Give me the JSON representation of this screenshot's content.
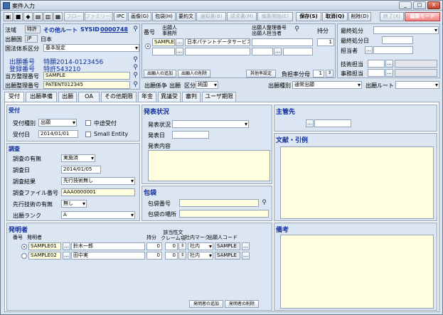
{
  "window": {
    "title": "案件入力",
    "min": "_",
    "max": "□",
    "close": "X"
  },
  "toolbar": {
    "flow": "フロー",
    "family": "ファミリー(F)",
    "ipc": "IPC",
    "image": "画像(G)",
    "package": "包袋(H)",
    "summary": "要約文",
    "notice": "通知書(B)",
    "request": "請求書(M)",
    "edit_start": "編集開始(E)",
    "save": "保存(S)",
    "cancel": "取消(Q)",
    "delete": "削除(D)",
    "exit": "終了(X)",
    "edit_mode": "編集モード"
  },
  "header": {
    "law_label": "法域",
    "law_value": "特許",
    "route_label": "その他ルート",
    "sysid_label": "SYSID",
    "sysid_value": "0000748",
    "country_label": "出願国",
    "country_code": "JP",
    "country_name": "日本",
    "intl_label": "国法体系区分",
    "intl_value": "基本設定",
    "appno_label": "出願番号",
    "appno_value": "特願2014-0123456",
    "regno_label": "登録番号",
    "regno_value": "特許543210",
    "ourref_label": "当方整理番号",
    "ourref_value": "SAMPLE",
    "apprefno_label": "出願整理番号",
    "apprefno_value": "PATENT012345"
  },
  "applicant": {
    "col_num": "番号",
    "col_applicant": "出願人\n事務所",
    "col_refno": "出願人整理番号\n出願人担当者",
    "col_share": "持分",
    "row_code": "SAMPLE",
    "row_name": "日本パテントデータサービス株式",
    "row_share": "1",
    "add_btn": "出願人の追加",
    "del_btn": "出願人の削除",
    "settle_btn": "其他率設定",
    "ratio_label": "負担率分母",
    "ratio_value": "1"
  },
  "right_top": {
    "status_label": "最終処分",
    "status_date_label": "最終処分日",
    "person_label": "担当者",
    "tech_label": "技術担当",
    "office_label": "事務担当"
  },
  "attrs": {
    "reason_label": "出願係争",
    "app_label": "出願",
    "kind_label": "区分",
    "kind_value": "純国",
    "type_label": "出願種別",
    "type_value": "通常出願",
    "route_label": "出願ルート"
  },
  "tabs": [
    "受付",
    "出願準備",
    "出願",
    "OA",
    "その他期限",
    "年金",
    "異議受",
    "審判",
    "ユーザ期限"
  ],
  "reception": {
    "title": "受付",
    "type_label": "受付種別",
    "type_value": "出願",
    "midway_label": "中途受付",
    "date_label": "受付日",
    "date_value": "2014/01/01",
    "small_label": "Small Entity"
  },
  "survey": {
    "title": "調査",
    "has_label": "調査の有無",
    "has_value": "実施済",
    "date_label": "調査日",
    "date_value": "2014/01/05",
    "result_label": "調査結果",
    "result_value": "先行技術無し",
    "file_label": "調査ファイル番号",
    "file_value": "AAA0000001",
    "prior_label": "先行技術の有無",
    "prior_value": "無し",
    "rank_label": "出願ランク",
    "rank_value": "A"
  },
  "invention": {
    "title": "発表状況",
    "status_label": "発表状況",
    "date_label": "発表日",
    "content_label": "発表内容"
  },
  "package": {
    "title": "包袋",
    "no_label": "包袋番号",
    "loc_label": "包袋の場所"
  },
  "owner": {
    "title": "主管先"
  },
  "refs": {
    "title": "文献・引例"
  },
  "inventors": {
    "title": "発明者",
    "col_num": "番号",
    "col_name": "発明者",
    "col_share": "持分",
    "col_claim": "該当性文\nクレーム項",
    "col_mark": "社内マーク",
    "col_code": "出願人コード",
    "rows": [
      {
        "code": "SAMPLE01",
        "name": "鈴木一郎",
        "share": "0",
        "claim": "0",
        "mark": "社内",
        "appcode": "SAMPLE"
      },
      {
        "code": "SAMPLE02",
        "name": "田中実",
        "share": "0",
        "claim": "0",
        "mark": "社内",
        "appcode": "SAMPLE"
      }
    ],
    "add_btn": "発明者の追加",
    "del_btn": "発明者の削除"
  },
  "notes": {
    "title": "備考"
  }
}
